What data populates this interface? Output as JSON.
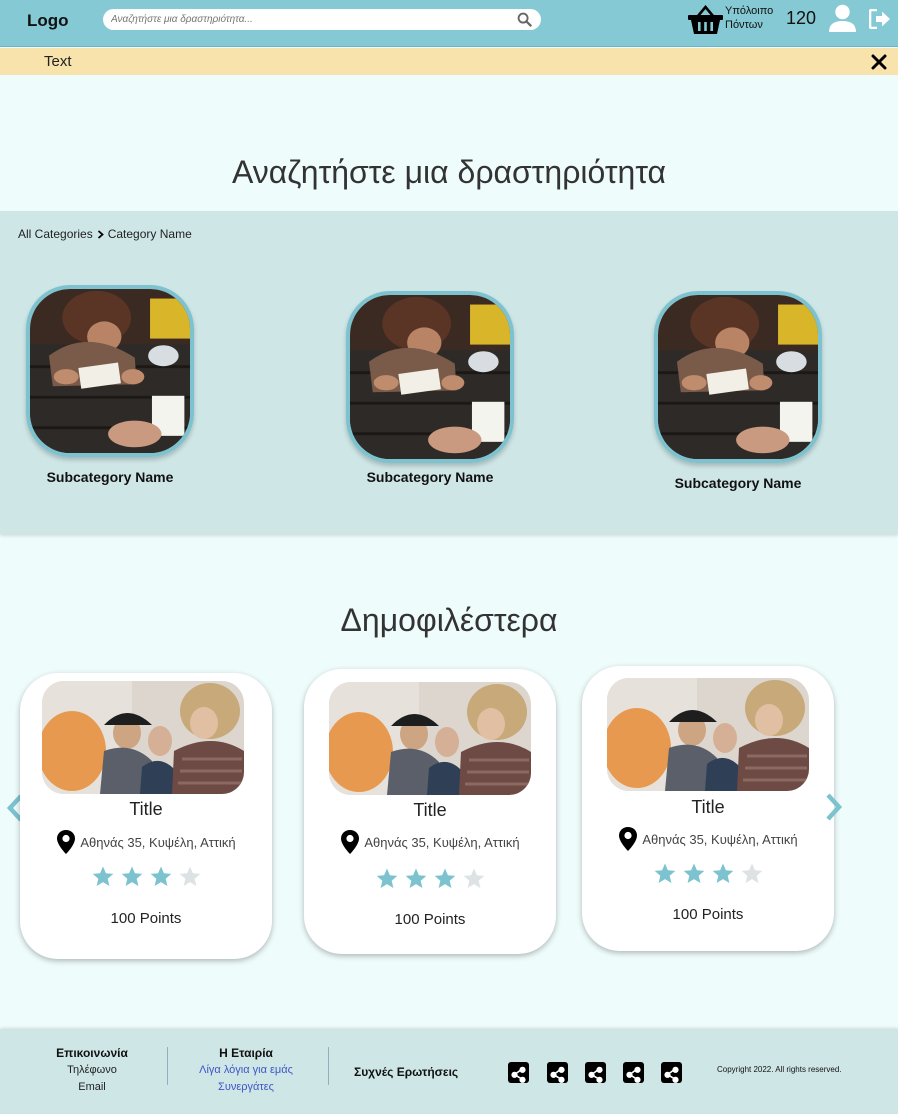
{
  "header": {
    "logo": "Logo",
    "search_placeholder": "Αναζητήστε μια δραστηριότητα...",
    "points_label_line1": "Υπόλοιπο",
    "points_label_line2": "Πόντων",
    "points_value": "120"
  },
  "notice": {
    "text": "Text"
  },
  "search_section": {
    "heading": "Αναζητήστε μια δραστηριότητα"
  },
  "categories": {
    "breadcrumb": [
      "All Categories",
      "Category Name"
    ],
    "subcategories": [
      {
        "name": "Subcategory Name"
      },
      {
        "name": "Subcategory Name"
      },
      {
        "name": "Subcategory Name"
      }
    ]
  },
  "popular": {
    "heading": "Δημοφιλέστερα",
    "cards": [
      {
        "title": "Title",
        "location": "Αθηνάς 35, Κυψέλη, Αττική",
        "rating": 3,
        "rating_max": 4,
        "points": "100 Points"
      },
      {
        "title": "Title",
        "location": "Αθηνάς 35, Κυψέλη, Αττική",
        "rating": 3,
        "rating_max": 4,
        "points": "100 Points"
      },
      {
        "title": "Title",
        "location": "Αθηνάς 35, Κυψέλη, Αττική",
        "rating": 3,
        "rating_max": 4,
        "points": "100 Points"
      }
    ]
  },
  "footer": {
    "contact": {
      "heading": "Επικοινωνία",
      "phone": "Τηλέφωνο",
      "email": "Email"
    },
    "company": {
      "heading": "Η Εταιρία",
      "about": "Λίγα λόγια για εμάς",
      "partners": "Συνεργάτες"
    },
    "faq": "Συχνές Ερωτήσεις",
    "copyright": "Copyright 2022. All rights reserved."
  },
  "colors": {
    "header": "#84c9d3",
    "notice": "#f7e3ab",
    "band": "#cfe6e7",
    "accent": "#7cc3cf",
    "star_on": "#7cc3cf",
    "star_off": "#dde3e4",
    "link": "#3f55c4"
  },
  "icons": [
    "search-icon",
    "basket-icon",
    "user-icon",
    "logout-icon",
    "close-icon",
    "chevron-right-icon",
    "location-pin-icon",
    "star-icon",
    "chevron-left-icon",
    "share-icon"
  ]
}
